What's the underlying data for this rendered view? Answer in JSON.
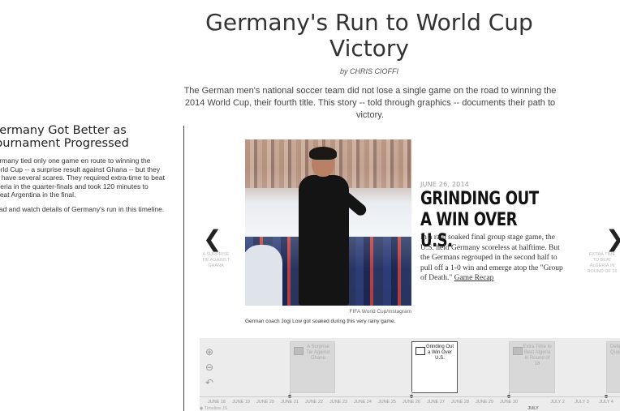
{
  "header": {
    "title": "Germany's Run to World Cup Victory",
    "byline": "by CHRIS CIOFFI",
    "intro": "The German men's national soccer team did not lose a single game on the road to winning the 2014 World Cup, their fourth title. This story -- told through graphics -- documents their path to victory."
  },
  "sidebar": {
    "heading": "Germany Got Better as Tournament Progressed",
    "paragraph1": "Germany tied only one game en route to winning the World Cup -- a surprise result against Ghana -- but they did have several scares. They required extra-time to beat Algeria in the quarter-finals and took 120 minutes to defeat Argentina in the final.",
    "paragraph2": "Read and watch details of Germany's run in this timeline."
  },
  "slide": {
    "prev_icon": "chevron-left-icon",
    "prev_glyph": "❮",
    "prev_label": "A SURPRISE TIE AGAINST GHANA",
    "next_icon": "chevron-right-icon",
    "next_glyph": "❯",
    "next_label": "EXTRA TIME TO BEAT ALGERIA IN ROUND OF 16",
    "photo_credit": "FIFA World Cup/Instagram",
    "caption": "German coach Jogi Low got soaked during this very rainy game.",
    "date": "JUNE 26, 2014",
    "headline": "GRINDING OUT A WIN OVER U.S.",
    "story": "In a rain soaked final group stage game, the U.S. held Germany scoreless at halftime. But the Germans regrouped in the second half to pull off a 1-0 win and emerge atop the \"Group of Death.\"",
    "story_link": "Game Recap"
  },
  "timeline": {
    "tools": {
      "zoom_in": "⊕",
      "zoom_out": "⊖",
      "back": "↶"
    },
    "cards": [
      {
        "label": "A Surprise Tie Against Ghana",
        "active": false
      },
      {
        "label": "Grinding Out a Win Over U.S.",
        "active": true
      },
      {
        "label": "Extra Time to Beat Algeria in Round of 16",
        "active": false
      },
      {
        "label": "Defe France Quar",
        "active": false
      }
    ],
    "ticks": [
      "JUNE 18",
      "JUNE 19",
      "JUNE 20",
      "JUNE 21",
      "JUNE 22",
      "JUNE 23",
      "JUNE 24",
      "JUNE 25",
      "JUNE 26",
      "JUNE 27",
      "JUNE 28",
      "JUNE 29",
      "JUNE 30",
      "JULY",
      "JULY 2",
      "JULY 3",
      "JULY 4"
    ],
    "month_label": "JULY",
    "credit": "Timeline JS"
  }
}
